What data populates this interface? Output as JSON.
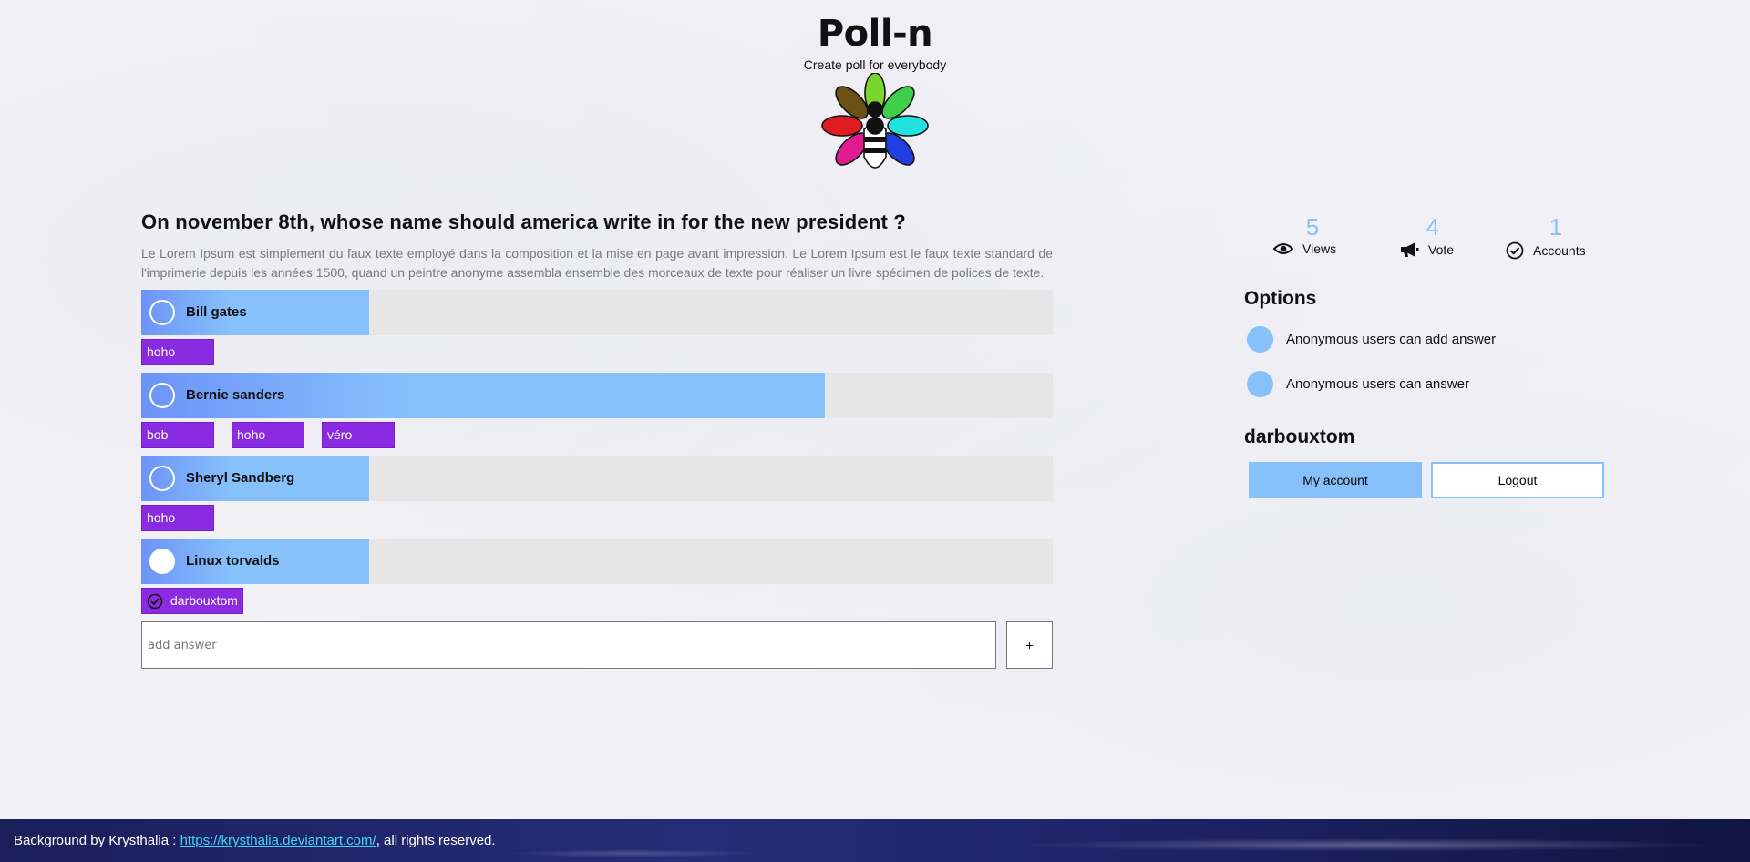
{
  "header": {
    "title": "Poll-n",
    "subtitle": "Create poll for everybody",
    "logo_icon": "flower-bee-logo"
  },
  "poll": {
    "question": "On november 8th, whose name should america write in for the new president ?",
    "description": "Le Lorem Ipsum est simplement du faux texte employé dans la composition et la mise en page avant impression. Le Lorem Ipsum est le faux texte standard de l'imprimerie depuis les années 1500, quand un peintre anonyme assembla ensemble des morceaux de texte pour réaliser un livre spécimen de polices de texte.",
    "answers": [
      {
        "label": "Bill gates",
        "share": 0.25,
        "checked": false,
        "voters": [
          "hoho"
        ]
      },
      {
        "label": "Bernie sanders",
        "share": 0.75,
        "checked": false,
        "voters": [
          "bob",
          "hoho",
          "véro"
        ]
      },
      {
        "label": "Sheryl Sandberg",
        "share": 0.25,
        "checked": false,
        "voters": [
          "hoho"
        ]
      },
      {
        "label": "Linux torvalds",
        "share": 0.25,
        "checked": true,
        "voters": [
          "darbouxtom"
        ]
      }
    ],
    "add_answer": {
      "placeholder": "add answer",
      "value": "",
      "button_label": "+"
    }
  },
  "stats": {
    "views": {
      "value": "5",
      "label": "Views",
      "icon": "eye-icon"
    },
    "votes": {
      "value": "4",
      "label": "Vote",
      "icon": "megaphone-icon"
    },
    "accounts": {
      "value": "1",
      "label": "Accounts",
      "icon": "check-circle-icon"
    }
  },
  "options": {
    "title": "Options",
    "items": [
      {
        "label": "Anonymous users can add answer"
      },
      {
        "label": "Anonymous users can answer"
      }
    ]
  },
  "user": {
    "name": "darbouxtom",
    "account_label": "My account",
    "logout_label": "Logout"
  },
  "footer": {
    "prefix": "Background by Krysthalia : ",
    "link_text": "https://krysthalia.deviantart.com/",
    "suffix": ", all rights reserved."
  },
  "colors": {
    "accent": "#86c1fb",
    "accent_dark": "#6d93f8",
    "voter_tag": "#8a2be2",
    "bar_bg": "#e6e6e6"
  }
}
